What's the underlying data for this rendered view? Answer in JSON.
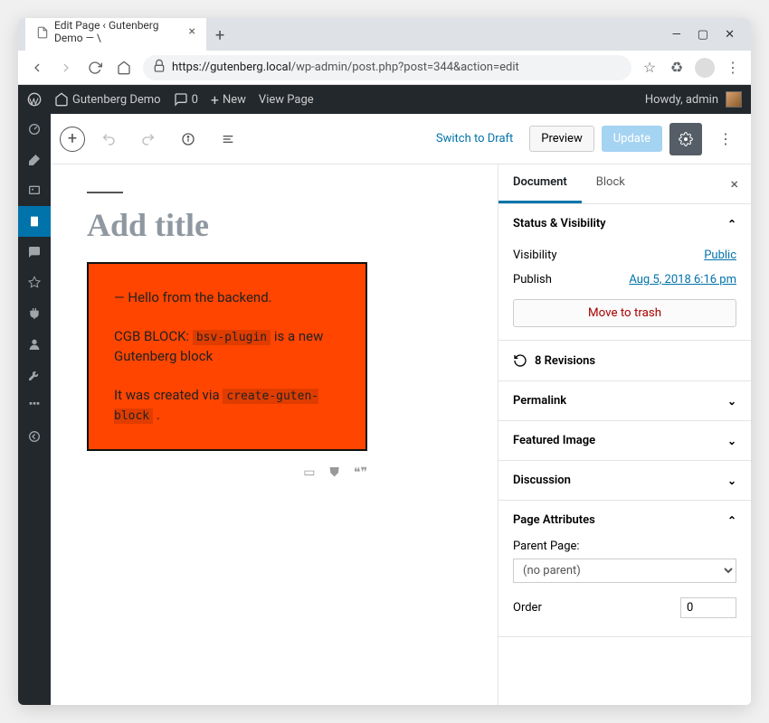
{
  "browser": {
    "tab_title": "Edit Page ‹ Gutenberg Demo — \\",
    "url_host": "https://gutenberg.local",
    "url_path": "/wp-admin/post.php?post=344&action=edit"
  },
  "adminbar": {
    "site_name": "Gutenberg Demo",
    "comments": "0",
    "new_label": "New",
    "view_label": "View Page",
    "howdy": "Howdy, admin"
  },
  "editor_toolbar": {
    "switch_draft": "Switch to Draft",
    "preview": "Preview",
    "publish": "Update"
  },
  "canvas": {
    "title_placeholder": "Add title",
    "block": {
      "hello": "— Hello from the backend.",
      "line2_prefix": "CGB BLOCK: ",
      "code1": "bsv-plugin",
      "line2_suffix": " is a new Gutenberg block",
      "line3_prefix": "It was created via ",
      "code2": "create-guten-block",
      "line3_suffix": " ."
    }
  },
  "sidebar": {
    "tab_document": "Document",
    "tab_block": "Block",
    "status_visibility": {
      "title": "Status & Visibility",
      "visibility_label": "Visibility",
      "visibility_value": "Public",
      "publish_label": "Publish",
      "publish_value": "Aug 5, 2018 6:16 pm",
      "trash": "Move to trash"
    },
    "revisions": {
      "label": "8 Revisions"
    },
    "permalink": {
      "title": "Permalink"
    },
    "featured_image": {
      "title": "Featured Image"
    },
    "discussion": {
      "title": "Discussion"
    },
    "page_attributes": {
      "title": "Page Attributes",
      "parent_label": "Parent Page:",
      "parent_value": "(no parent)",
      "order_label": "Order",
      "order_value": "0"
    }
  }
}
